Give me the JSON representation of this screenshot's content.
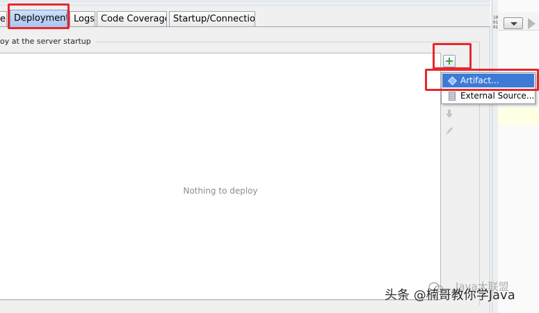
{
  "tabs": [
    {
      "label": "er",
      "active": false
    },
    {
      "label": "Deployment",
      "active": true
    },
    {
      "label": "Logs",
      "active": false
    },
    {
      "label": "Code Coverage",
      "active": false
    },
    {
      "label": "Startup/Connection",
      "active": false
    }
  ],
  "deploy_group": {
    "legend": "oy at the server startup",
    "empty_text": "Nothing to deploy"
  },
  "toolbar": {
    "add_icon": "plus-icon",
    "move_down_icon": "arrow-down-icon",
    "edit_icon": "pencil-icon"
  },
  "add_menu": {
    "items": [
      {
        "label": "Artifact...",
        "icon": "artifact-icon",
        "highlighted": true
      },
      {
        "label": "External Source...",
        "icon": "external-source-icon",
        "highlighted": false
      }
    ]
  },
  "right_panel": {
    "binary_text": "10 01 01"
  },
  "watermark": {
    "text": "头条 @楠哥教你学Java",
    "faded_text": "Java大联盟"
  },
  "colors": {
    "highlight_red": "#e8262b",
    "menu_selection": "#3e7bd6",
    "active_tab": "#a9c5f0",
    "add_green": "#3aa33a"
  }
}
